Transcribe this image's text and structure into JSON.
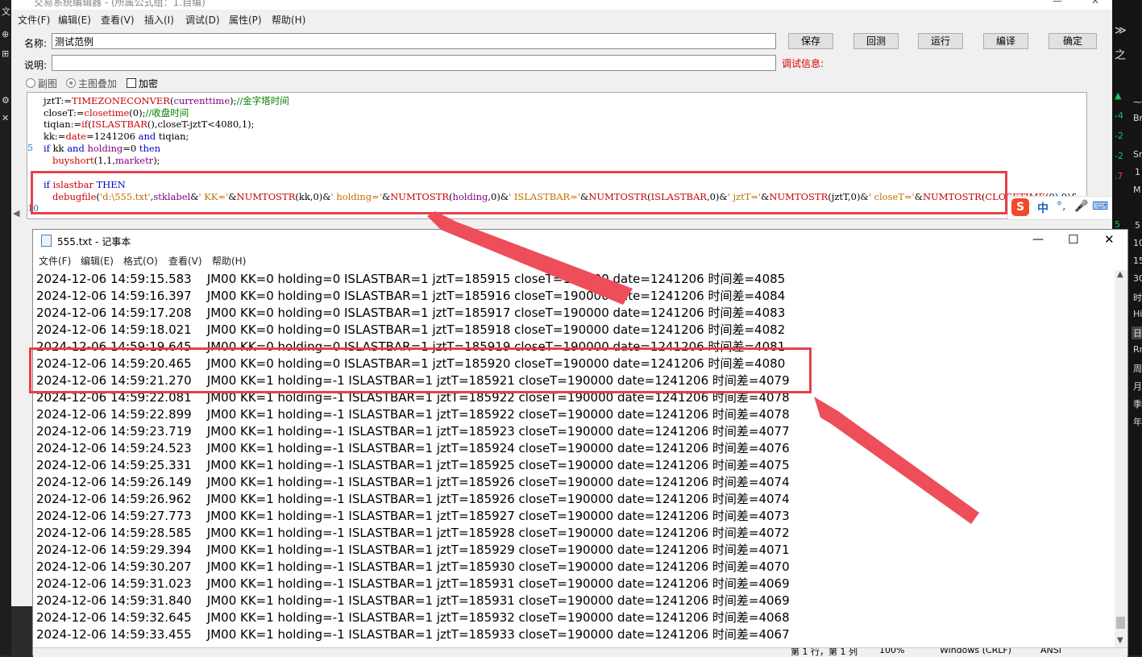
{
  "editor": {
    "title": "交易系统编辑器 - (所属公式组：1.自编)",
    "menu": [
      "文件(F)",
      "编辑(E)",
      "查看(V)",
      "插入(I)",
      "调试(D)",
      "属性(P)",
      "帮助(H)"
    ],
    "name_label": "名称:",
    "name_value": "测试范例",
    "desc_label": "说明:",
    "desc_value": "",
    "buttons": [
      "保存",
      "回测",
      "运行",
      "编译",
      "确定"
    ],
    "debug_info_label": "调试信息:",
    "radio_sub": "副图",
    "radio_main": "主图叠加",
    "checkbox_encrypt": "加密",
    "line_numbers": [
      "5",
      "10"
    ]
  },
  "notepad": {
    "title": "555.txt - 记事本",
    "menu": [
      "文件(F)",
      "编辑(E)",
      "格式(O)",
      "查看(V)",
      "帮助(H)"
    ],
    "lines": [
      "2024-12-06 14:59:15.583    JM00 KK=0 holding=0 ISLASTBAR=1 jztT=185915 closeT=190000 date=1241206 时间差=4085",
      "2024-12-06 14:59:16.397    JM00 KK=0 holding=0 ISLASTBAR=1 jztT=185916 closeT=190000 date=1241206 时间差=4084",
      "2024-12-06 14:59:17.208    JM00 KK=0 holding=0 ISLASTBAR=1 jztT=185917 closeT=190000 date=1241206 时间差=4083",
      "2024-12-06 14:59:18.021    JM00 KK=0 holding=0 ISLASTBAR=1 jztT=185918 closeT=190000 date=1241206 时间差=4082",
      "2024-12-06 14:59:19.645    JM00 KK=0 holding=0 ISLASTBAR=1 jztT=185919 closeT=190000 date=1241206 时间差=4081",
      "2024-12-06 14:59:20.465    JM00 KK=0 holding=0 ISLASTBAR=1 jztT=185920 closeT=190000 date=1241206 时间差=4080",
      "2024-12-06 14:59:21.270    JM00 KK=1 holding=-1 ISLASTBAR=1 jztT=185921 closeT=190000 date=1241206 时间差=4079",
      "2024-12-06 14:59:22.081    JM00 KK=1 holding=-1 ISLASTBAR=1 jztT=185922 closeT=190000 date=1241206 时间差=4078",
      "2024-12-06 14:59:22.899    JM00 KK=1 holding=-1 ISLASTBAR=1 jztT=185922 closeT=190000 date=1241206 时间差=4078",
      "2024-12-06 14:59:23.719    JM00 KK=1 holding=-1 ISLASTBAR=1 jztT=185923 closeT=190000 date=1241206 时间差=4077",
      "2024-12-06 14:59:24.523    JM00 KK=1 holding=-1 ISLASTBAR=1 jztT=185924 closeT=190000 date=1241206 时间差=4076",
      "2024-12-06 14:59:25.331    JM00 KK=1 holding=-1 ISLASTBAR=1 jztT=185925 closeT=190000 date=1241206 时间差=4075",
      "2024-12-06 14:59:26.149    JM00 KK=1 holding=-1 ISLASTBAR=1 jztT=185926 closeT=190000 date=1241206 时间差=4074",
      "2024-12-06 14:59:26.962    JM00 KK=1 holding=-1 ISLASTBAR=1 jztT=185926 closeT=190000 date=1241206 时间差=4074",
      "2024-12-06 14:59:27.773    JM00 KK=1 holding=-1 ISLASTBAR=1 jztT=185927 closeT=190000 date=1241206 时间差=4073",
      "2024-12-06 14:59:28.585    JM00 KK=1 holding=-1 ISLASTBAR=1 jztT=185928 closeT=190000 date=1241206 时间差=4072",
      "2024-12-06 14:59:29.394    JM00 KK=1 holding=-1 ISLASTBAR=1 jztT=185929 closeT=190000 date=1241206 时间差=4071",
      "2024-12-06 14:59:30.207    JM00 KK=1 holding=-1 ISLASTBAR=1 jztT=185930 closeT=190000 date=1241206 时间差=4070",
      "2024-12-06 14:59:31.023    JM00 KK=1 holding=-1 ISLASTBAR=1 jztT=185931 closeT=190000 date=1241206 时间差=4069",
      "2024-12-06 14:59:31.840    JM00 KK=1 holding=-1 ISLASTBAR=1 jztT=185931 closeT=190000 date=1241206 时间差=4069",
      "2024-12-06 14:59:32.645    JM00 KK=1 holding=-1 ISLASTBAR=1 jztT=185932 closeT=190000 date=1241206 时间差=4068",
      "2024-12-06 14:59:33.455    JM00 KK=1 holding=-1 ISLASTBAR=1 jztT=185933 closeT=190000 date=1241206 时间差=4067"
    ],
    "status": [
      "第 1 行，第 1 列",
      "100%",
      "Windows (CRLF)",
      "ANSI"
    ]
  },
  "right_panel": {
    "items": [
      "Br",
      "Sr",
      "1",
      "M",
      "5",
      "10",
      "15",
      "30",
      "时",
      "Hi",
      "日",
      "Rr",
      "周",
      "月",
      "季",
      "年"
    ],
    "numbers": [
      "-4",
      "-2",
      "-2",
      ".7",
      "5"
    ]
  },
  "ime": {
    "mode": "中"
  },
  "colors": {
    "highlight": "#e8404a",
    "keyword": "#0000cc",
    "function": "#cc0000",
    "comment": "#008000"
  }
}
